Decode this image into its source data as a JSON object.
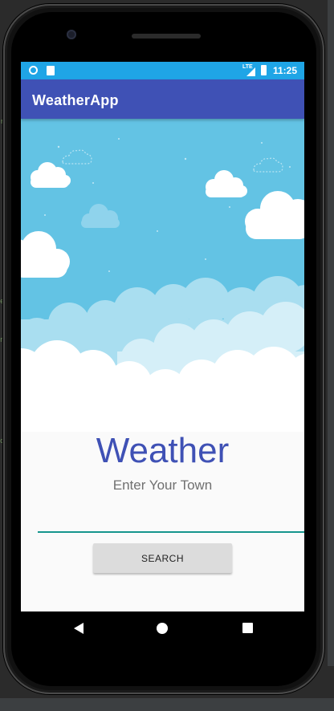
{
  "status_bar": {
    "time": "11:25",
    "network_label": "LTE",
    "icons": [
      "circle-notification-icon",
      "sd-card-icon",
      "signal-icon",
      "battery-icon"
    ]
  },
  "app_bar": {
    "title": "WeatherApp"
  },
  "main": {
    "heading": "Weather",
    "subtitle": "Enter Your Town",
    "town_input": {
      "value": "",
      "placeholder": ""
    },
    "search_button_label": "SEARCH"
  },
  "nav_bar": {
    "icons": [
      "back-icon",
      "home-icon",
      "recents-icon"
    ]
  },
  "colors": {
    "status_bar": "#1fa5e6",
    "app_bar": "#3f51b5",
    "heading": "#3f51b5",
    "input_underline": "#15958d",
    "sky": "#63c3e4",
    "button": "#dcdcdc"
  }
}
